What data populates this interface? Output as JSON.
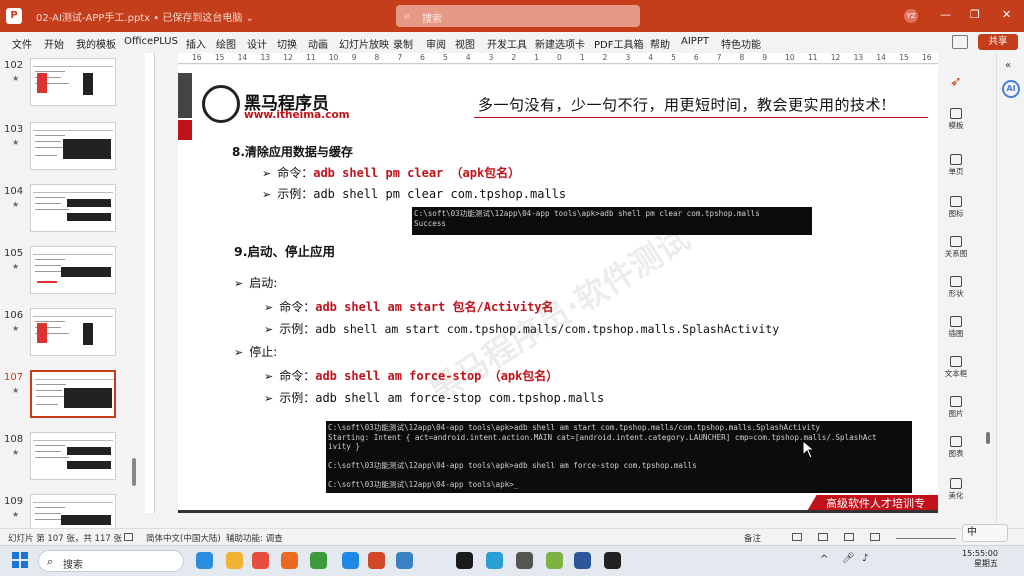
{
  "window": {
    "title": "02-AI测试-APP手工.pptx • 已保存到这台电脑 ⌄",
    "search_placeholder": "搜索",
    "user_badge": "YZ"
  },
  "menu": [
    "文件",
    "开始",
    "我的模板",
    "OfficePLUS",
    "插入",
    "绘图",
    "设计",
    "切换",
    "动画",
    "幻灯片放映",
    "录制",
    "审阅",
    "视图",
    "开发工具",
    "新建选项卡",
    "PDF工具箱",
    "帮助",
    "AIPPT",
    "特色功能"
  ],
  "share_label": "共享",
  "thumbnails": [
    {
      "num": "102"
    },
    {
      "num": "103"
    },
    {
      "num": "104"
    },
    {
      "num": "105"
    },
    {
      "num": "106"
    },
    {
      "num": "107",
      "selected": true
    },
    {
      "num": "108"
    },
    {
      "num": "109"
    }
  ],
  "ruler_ticks": [
    "16",
    "15",
    "14",
    "13",
    "12",
    "11",
    "10",
    "9",
    "8",
    "7",
    "6",
    "5",
    "4",
    "3",
    "2",
    "1",
    "0",
    "1",
    "2",
    "3",
    "4",
    "5",
    "6",
    "7",
    "8",
    "9",
    "10",
    "11",
    "12",
    "13",
    "14",
    "15",
    "16"
  ],
  "slide": {
    "logo_cn": "黑马程序员",
    "logo_url": "www.itheima.com",
    "slogan": "多一句没有，少一句不行，用更短时间，教会更实用的技术!",
    "sec8_title": "8.清除应用数据与缓存",
    "sec8_cmd_label": "命令：",
    "sec8_cmd": "adb shell pm clear  （apk包名）",
    "sec8_ex_label": "示例：",
    "sec8_ex": "adb shell pm clear com.tpshop.malls",
    "term1": "C:\\soft\\03功能测试\\12app\\04-app tools\\apk>adb shell pm clear com.tpshop.malls\nSuccess",
    "sec9_title": "9.启动、停止应用",
    "start_label": "启动:",
    "start_cmd_label": "命令：",
    "start_cmd": "adb shell am start  包名/Activity名",
    "start_ex_label": "示例：",
    "start_ex": "adb shell am start com.tpshop.malls/com.tpshop.malls.SplashActivity",
    "stop_label": "停止:",
    "stop_cmd_label": "命令：",
    "stop_cmd": "adb shell am force-stop  （apk包名）",
    "stop_ex_label": "示例：",
    "stop_ex": "adb shell am force-stop com.tpshop.malls",
    "term2": "C:\\soft\\03功能测试\\12app\\04-app tools\\apk>adb shell am start com.tpshop.malls/com.tpshop.malls.SplashActivity\nStarting: Intent { act=android.intent.action.MAIN cat=[android.intent.category.LAUNCHER] cmp=com.tpshop.malls/.SplashAct\nivity }\n\nC:\\soft\\03功能测试\\12app\\04-app tools\\apk>adb shell am force-stop com.tpshop.malls\n\nC:\\soft\\03功能测试\\12app\\04-app tools\\apk>_",
    "watermark": "黑马程序员·软件测试",
    "footer_banner": "高级软件人才培训专"
  },
  "right_panel": [
    "模板",
    "单页",
    "图标",
    "关系图",
    "形状",
    "插图",
    "文本框",
    "图片",
    "图表",
    "美化"
  ],
  "status": {
    "slide_count": "幻灯片 第 107 张，共 117 张",
    "language": "简体中文(中国大陆)",
    "accessibility": "辅助功能: 调查",
    "notes": "备注"
  },
  "taskbar": {
    "search_label": "搜索",
    "ime": "中",
    "time": "15:55:00",
    "date": "星期五"
  },
  "colors": {
    "accent": "#c43e1c",
    "brand_red": "#c1121b"
  }
}
